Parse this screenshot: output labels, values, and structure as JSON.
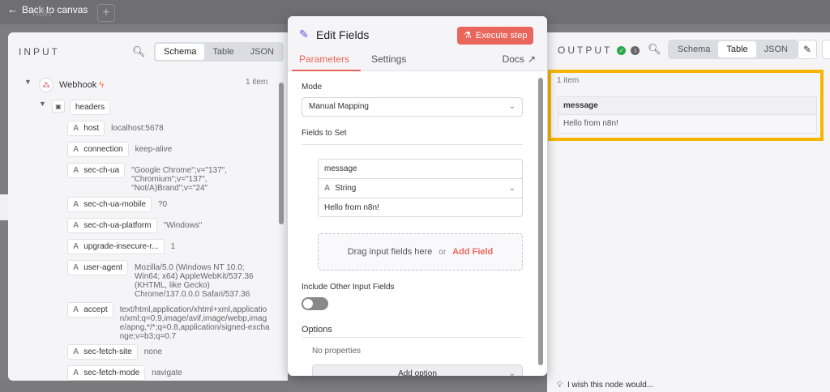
{
  "topbar": {
    "back_label": "Back to canvas",
    "bg_node_title": "n8n",
    "plus": "+"
  },
  "input_panel": {
    "title": "INPUT",
    "view_tabs": [
      "Schema",
      "Table",
      "JSON"
    ],
    "active_view": "Schema",
    "node": {
      "name": "Webhook",
      "item_count": "1 item"
    },
    "group": "headers",
    "fields": [
      {
        "key": "host",
        "value": "localhost:5678"
      },
      {
        "key": "connection",
        "value": "keep-alive"
      },
      {
        "key": "sec-ch-ua",
        "value": "\"Google Chrome\";v=\"137\", \"Chromium\";v=\"137\", \"Not/A)Brand\";v=\"24\""
      },
      {
        "key": "sec-ch-ua-mobile",
        "value": "?0"
      },
      {
        "key": "sec-ch-ua-platform",
        "value": "\"Windows\""
      },
      {
        "key": "upgrade-insecure-r...",
        "value": "1"
      },
      {
        "key": "user-agent",
        "value": "Mozilla/5.0 (Windows NT 10.0; Win64; x64) AppleWebKit/537.36 (KHTML, like Gecko) Chrome/137.0.0.0 Safari/537.36"
      },
      {
        "key": "accept",
        "value": "text/html,application/xhtml+xml,application/xml;q=0.9,image/avif,image/webp,image/apng,*/*;q=0.8,application/signed-exchange;v=b3;q=0.7"
      },
      {
        "key": "sec-fetch-site",
        "value": "none"
      },
      {
        "key": "sec-fetch-mode",
        "value": "navigate"
      }
    ],
    "type_glyph": "A"
  },
  "modal": {
    "title": "Edit Fields",
    "execute_label": "Execute step",
    "tabs": [
      "Parameters",
      "Settings"
    ],
    "docs_label": "Docs",
    "mode_label": "Mode",
    "mode_value": "Manual Mapping",
    "fields_to_set_label": "Fields to Set",
    "field": {
      "name": "message",
      "type": "String",
      "value": "Hello from n8n!"
    },
    "drop_text": "Drag input fields here",
    "drop_or": "or",
    "add_field": "Add Field",
    "include_other_label": "Include Other Input Fields",
    "include_other_on": false,
    "options_label": "Options",
    "no_properties": "No properties",
    "add_option": "Add option"
  },
  "output_panel": {
    "title": "OUTPUT",
    "view_tabs": [
      "Schema",
      "Table",
      "JSON"
    ],
    "active_view": "Table",
    "item_count": "1 item",
    "table": {
      "header": "message",
      "row": "Hello from n8n!"
    },
    "feedback": "I wish this node would..."
  }
}
